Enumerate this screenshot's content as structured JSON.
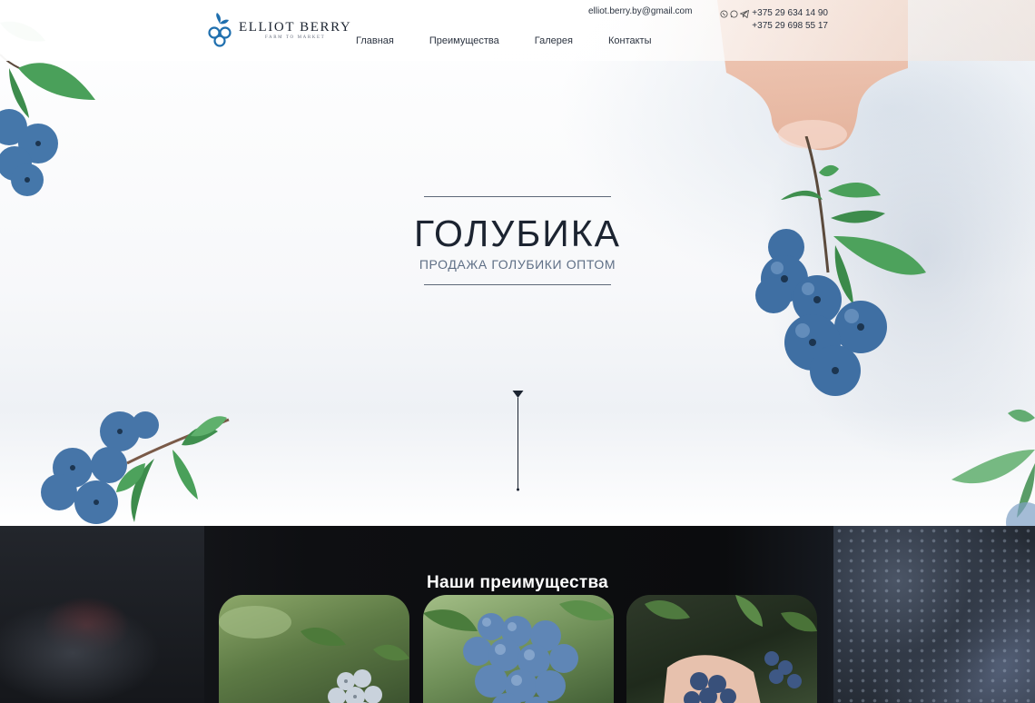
{
  "header": {
    "logo": {
      "name": "ELLIOT BERRY",
      "tagline": "FARM TO MARKET"
    },
    "nav": [
      {
        "label": "Главная"
      },
      {
        "label": "Преимущества"
      },
      {
        "label": "Галерея"
      },
      {
        "label": "Контакты"
      }
    ],
    "email": "elliot.berry.by@gmail.com",
    "phones": [
      "+375 29 634 14 90",
      "+375 29 698 55 17"
    ],
    "messenger_icons": [
      "viber-icon",
      "whatsapp-icon",
      "telegram-icon"
    ]
  },
  "hero": {
    "title": "ГОЛУБИКА",
    "subtitle": "ПРОДАЖА ГОЛУБИКИ ОПТОМ"
  },
  "advantages": {
    "title": "Наши преимущества"
  },
  "colors": {
    "brand_blue": "#1f6fae",
    "berry": "#3e6d9e",
    "leaf": "#4b9a5a",
    "text_dark": "#1c2431"
  }
}
